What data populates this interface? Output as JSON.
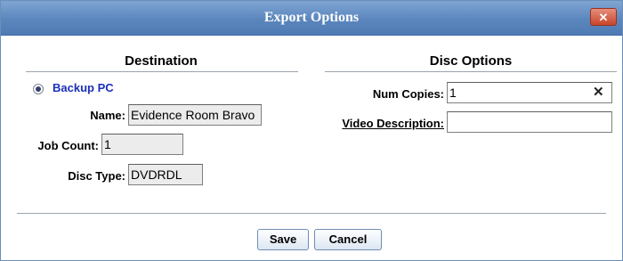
{
  "dialog": {
    "title": "Export Options",
    "close_glyph": "✕",
    "close_icon": "close-icon"
  },
  "destination": {
    "heading": "Destination",
    "radio_label": "Backup PC",
    "radio_selected": true,
    "name_label": "Name:",
    "name_value": "Evidence Room Bravo",
    "job_count_label": "Job Count:",
    "job_count_value": "1",
    "disc_type_label": "Disc Type:",
    "disc_type_value": "DVDRDL"
  },
  "disc_options": {
    "heading": "Disc Options",
    "num_copies_label": "Num Copies:",
    "num_copies_value": "1",
    "clear_glyph": "✕",
    "video_description_label": "Video Description:",
    "video_description_value": ""
  },
  "buttons": {
    "save": "Save",
    "cancel": "Cancel"
  }
}
